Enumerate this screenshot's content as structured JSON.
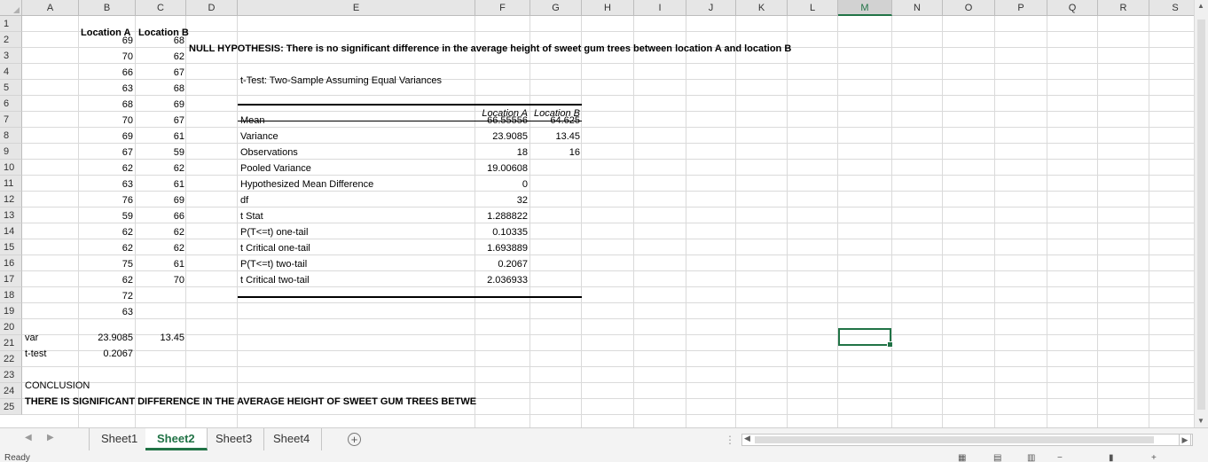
{
  "columns": [
    "A",
    "B",
    "C",
    "D",
    "E",
    "F",
    "G",
    "H",
    "I",
    "J",
    "K",
    "L",
    "M",
    "N",
    "O",
    "P",
    "Q",
    "R",
    "S"
  ],
  "selected_column": "M",
  "rows": [
    "1",
    "2",
    "3",
    "4",
    "5",
    "6",
    "7",
    "8",
    "9",
    "10",
    "11",
    "12",
    "13",
    "14",
    "15",
    "16",
    "17",
    "18",
    "19",
    "20",
    "21",
    "22",
    "23",
    "24",
    "25"
  ],
  "headers": {
    "loc_a": "Location A",
    "loc_b": "Location B"
  },
  "location_a": [
    "69",
    "70",
    "66",
    "63",
    "68",
    "70",
    "69",
    "67",
    "62",
    "63",
    "76",
    "59",
    "62",
    "62",
    "75",
    "62",
    "72",
    "63"
  ],
  "location_b": [
    "68",
    "62",
    "67",
    "68",
    "69",
    "67",
    "61",
    "59",
    "62",
    "61",
    "69",
    "66",
    "62",
    "62",
    "61",
    "70"
  ],
  "null_hypothesis": "NULL HYPOTHESIS: There is no significant difference in the average height of sweet gum trees between location A and location B",
  "ttest": {
    "title": "t-Test: Two-Sample Assuming Equal Variances",
    "col_a": "Location A",
    "col_b": "Location B",
    "rows": [
      {
        "label": "Mean",
        "a": "66.55556",
        "b": "64.625"
      },
      {
        "label": "Variance",
        "a": "23.9085",
        "b": "13.45"
      },
      {
        "label": "Observations",
        "a": "18",
        "b": "16"
      },
      {
        "label": "Pooled Variance",
        "a": "19.00608",
        "b": ""
      },
      {
        "label": "Hypothesized Mean Difference",
        "a": "0",
        "b": ""
      },
      {
        "label": "df",
        "a": "32",
        "b": ""
      },
      {
        "label": "t Stat",
        "a": "1.288822",
        "b": ""
      },
      {
        "label": "P(T<=t) one-tail",
        "a": "0.10335",
        "b": ""
      },
      {
        "label": "t Critical one-tail",
        "a": "1.693889",
        "b": ""
      },
      {
        "label": "P(T<=t) two-tail",
        "a": "0.2067",
        "b": ""
      },
      {
        "label": "t Critical two-tail",
        "a": "2.036933",
        "b": ""
      }
    ]
  },
  "var_row": {
    "label": "var",
    "a": "23.9085",
    "b": "13.45"
  },
  "ttest_row": {
    "label": "t-test",
    "a": "0.2067"
  },
  "conclusion_label": "CONCLUSION",
  "conclusion_text": "THERE IS SIGNIFICANT DIFFERENCE IN THE AVERAGE HEIGHT OF SWEET GUM TREES BETWEEN PC",
  "sheets": [
    "Sheet1",
    "Sheet2",
    "Sheet3",
    "Sheet4"
  ],
  "active_sheet": "Sheet2",
  "status": {
    "ready": "Ready"
  }
}
